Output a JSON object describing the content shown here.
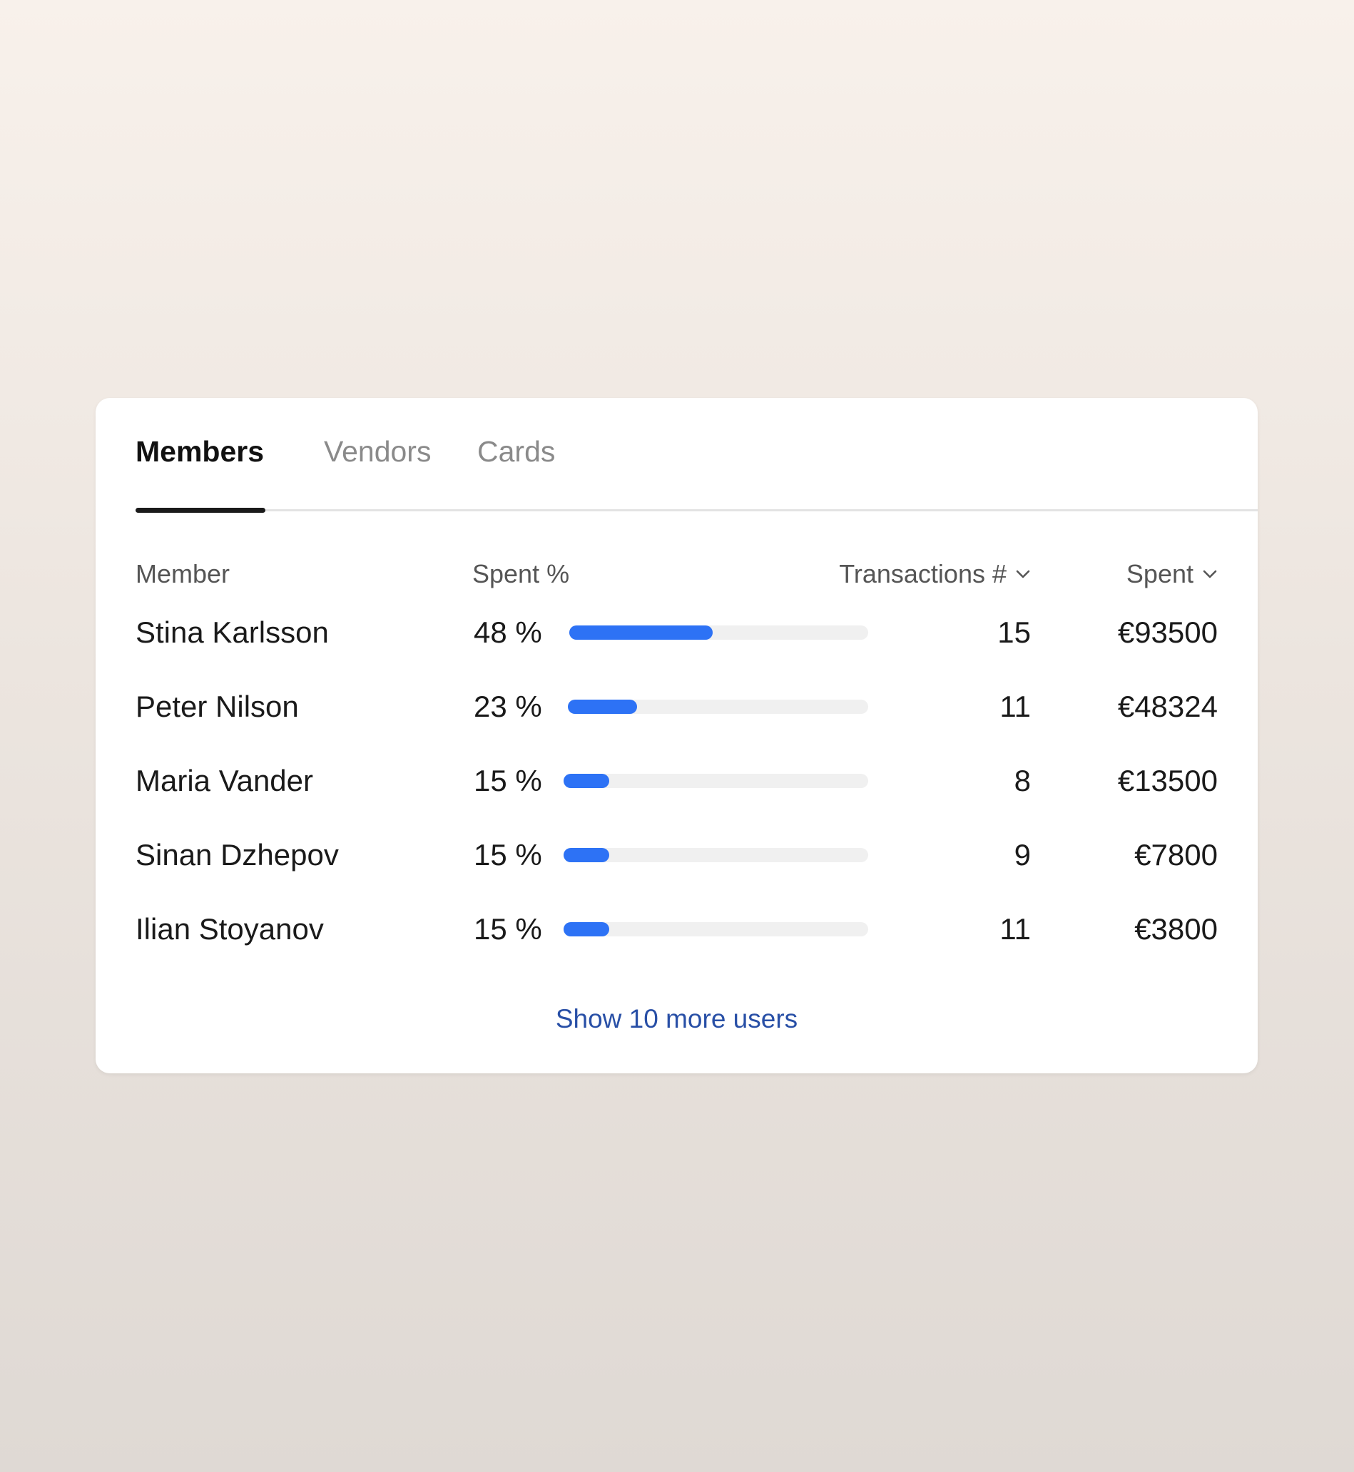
{
  "tabs": [
    {
      "label": "Members",
      "active": true
    },
    {
      "label": "Vendors",
      "active": false
    },
    {
      "label": "Cards",
      "active": false
    }
  ],
  "table": {
    "headers": {
      "member": "Member",
      "spent_pct": "Spent %",
      "transactions": "Transactions #",
      "spent": "Spent"
    },
    "rows": [
      {
        "name": "Stina Karlsson",
        "spent_pct_label": "48 %",
        "spent_pct": 48,
        "transactions": "15",
        "spent": "€93500"
      },
      {
        "name": "Peter Nilson",
        "spent_pct_label": "23 %",
        "spent_pct": 23,
        "transactions": "11",
        "spent": "€48324"
      },
      {
        "name": "Maria Vander",
        "spent_pct_label": "15 %",
        "spent_pct": 15,
        "transactions": "8",
        "spent": "€13500"
      },
      {
        "name": "Sinan Dzhepov",
        "spent_pct_label": "15 %",
        "spent_pct": 15,
        "transactions": "9",
        "spent": "€7800"
      },
      {
        "name": "Ilian Stoyanov",
        "spent_pct_label": "15 %",
        "spent_pct": 15,
        "transactions": "11",
        "spent": "€3800"
      }
    ]
  },
  "footer": {
    "more_label": "Show 10 more users"
  },
  "colors": {
    "accent": "#2d72f5",
    "link": "#284fa6",
    "track": "#f0f0f0"
  },
  "icons": {
    "sort": "chevron-down-icon"
  }
}
